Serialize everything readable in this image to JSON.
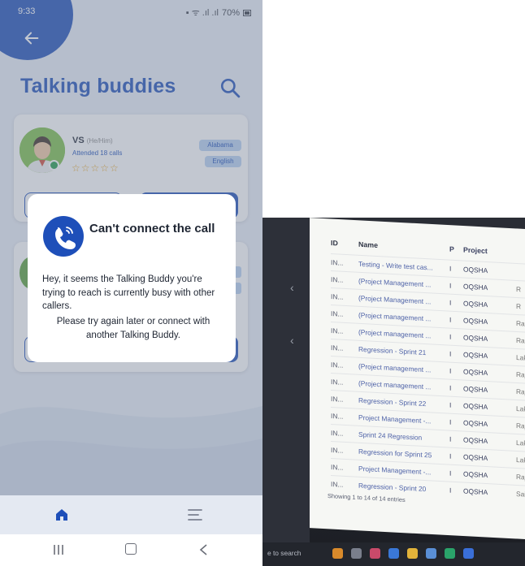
{
  "status_bar": {
    "time": "9:33",
    "battery": "70%"
  },
  "app": {
    "page_title": "Talking buddies"
  },
  "buddy_card": {
    "name": "VS",
    "pronouns": "(He/Him)",
    "calls": "Attended 18 calls",
    "rating_stars": "☆☆☆☆☆",
    "state_tag": "Alabama",
    "language_tag": "English"
  },
  "dialog": {
    "title": "Can't connect the call",
    "message": "Hey, it seems the Talking Buddy you're trying to reach is currently busy with other callers.",
    "message2": "Please try again later or connect with another Talking Buddy."
  },
  "colors": {
    "accent": "#1e4fb9",
    "tag_bg": "#b9d2f2",
    "online": "#1f9b4a"
  },
  "icons": {
    "back": "arrow-left-icon",
    "search": "search-icon",
    "call": "phone-icon",
    "home": "home-icon",
    "menu": "menu-icon"
  },
  "photo_table": {
    "headers": {
      "id": "ID",
      "name": "Name",
      "p": "P",
      "project": "Project"
    },
    "rows": [
      {
        "id": "IN...",
        "name": "Testing - Write test cas...",
        "p": "I",
        "project": "OQSHA"
      },
      {
        "id": "IN...",
        "name": "(Project Management ...",
        "p": "I",
        "project": "OQSHA"
      },
      {
        "id": "IN...",
        "name": "(Project Management ...",
        "p": "I",
        "project": "OQSHA"
      },
      {
        "id": "IN...",
        "name": "(Project management ...",
        "p": "I",
        "project": "OQSHA"
      },
      {
        "id": "IN...",
        "name": "(Project management ...",
        "p": "I",
        "project": "OQSHA"
      },
      {
        "id": "IN...",
        "name": "Regression - Sprint 21",
        "p": "I",
        "project": "OQSHA"
      },
      {
        "id": "IN...",
        "name": "(Project management ...",
        "p": "I",
        "project": "OQSHA"
      },
      {
        "id": "IN...",
        "name": "(Project management ...",
        "p": "I",
        "project": "OQSHA"
      },
      {
        "id": "IN...",
        "name": "Regression - Sprint 22",
        "p": "I",
        "project": "OQSHA"
      },
      {
        "id": "IN...",
        "name": "Project Management -...",
        "p": "I",
        "project": "OQSHA"
      },
      {
        "id": "IN...",
        "name": "Sprint 24 Regression",
        "p": "I",
        "project": "OQSHA"
      },
      {
        "id": "IN...",
        "name": "Regression for Sprint 25",
        "p": "I",
        "project": "OQSHA"
      },
      {
        "id": "IN...",
        "name": "Project Management -...",
        "p": "I",
        "project": "OQSHA"
      },
      {
        "id": "IN...",
        "name": "Regression - Sprint 20",
        "p": "I",
        "project": "OQSHA"
      }
    ],
    "owners": [
      "",
      "R",
      "R",
      "Ra",
      "Ra",
      "Lak",
      "Raj",
      "Raj K",
      "Laksh",
      "Raj K",
      "Laksh",
      "Laksh",
      "Raj K",
      "Sai p"
    ],
    "footer": "Showing 1 to 14 of 14 entries"
  },
  "taskbar": {
    "search_text": "e to search"
  }
}
